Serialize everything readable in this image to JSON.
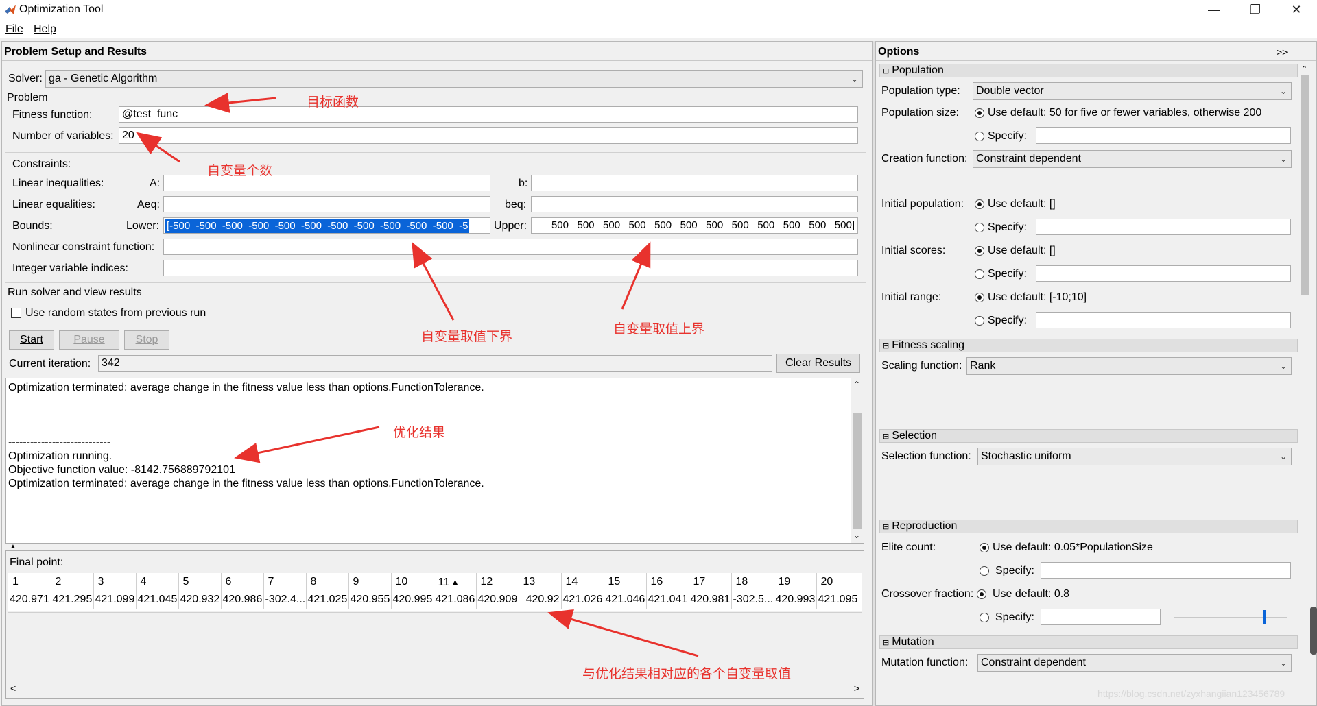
{
  "window": {
    "title": "Optimization Tool",
    "minimize": "—",
    "maximize": "❐",
    "close": "✕"
  },
  "menu": {
    "file": "File",
    "help": "Help"
  },
  "left": {
    "header": "Problem Setup and Results",
    "solver_label": "Solver:",
    "solver_value": "ga - Genetic Algorithm",
    "problem_label": "Problem",
    "fitness_label": "Fitness function:",
    "fitness_value": "@test_func",
    "nvars_label": "Number of variables:",
    "nvars_value": "20",
    "constraints_label": "Constraints:",
    "lin_ineq_label": "Linear inequalities:",
    "a_label": "A:",
    "b_label": "b:",
    "lin_eq_label": "Linear equalities:",
    "aeq_label": "Aeq:",
    "beq_label": "beq:",
    "bounds_label": "Bounds:",
    "lower_label": "Lower:",
    "lower_value": "[-500  -500  -500  -500  -500  -500  -500  -500  -500  -500  -500  -5",
    "upper_label": "Upper:",
    "upper_value": "500   500   500   500   500   500   500   500   500   500   500   500]",
    "nonlin_label": "Nonlinear constraint function:",
    "intvar_label": "Integer variable indices:",
    "run_label": "Run solver and view results",
    "random_states_label": "Use random states from previous run",
    "start_btn": "Start",
    "pause_btn": "Pause",
    "stop_btn": "Stop",
    "iter_label": "Current iteration:",
    "iter_value": "342",
    "clear_btn": "Clear Results",
    "output_lines": [
      "Optimization terminated: average change in the fitness value less than options.FunctionTolerance.",
      "",
      "",
      "",
      "----------------------------",
      "Optimization running.",
      "Objective function value: -8142.756889792101",
      "Optimization terminated: average change in the fitness value less than options.FunctionTolerance."
    ],
    "final_point_label": "Final point:",
    "final_headers": [
      "1",
      "2",
      "3",
      "4",
      "5",
      "6",
      "7",
      "8",
      "9",
      "10",
      "11 ▴",
      "12",
      "13",
      "14",
      "15",
      "16",
      "17",
      "18",
      "19",
      "20"
    ],
    "final_values": [
      "420.971",
      "421.295",
      "421.099",
      "421.045",
      "420.932",
      "420.986",
      "-302.4...",
      "421.025",
      "420.955",
      "420.995",
      "421.086",
      "420.909",
      "420.92",
      "421.026",
      "421.046",
      "421.041",
      "420.981",
      "-302.5...",
      "420.993",
      "421.095"
    ]
  },
  "options": {
    "header": "Options",
    "expand": ">>",
    "population": {
      "title": "Population",
      "type_label": "Population type:",
      "type_value": "Double vector",
      "size_label": "Population size:",
      "size_default": "Use default: 50 for five or fewer variables, otherwise 200",
      "specify": "Specify:",
      "creation_label": "Creation function:",
      "creation_value": "Constraint dependent",
      "init_pop_label": "Initial population:",
      "init_pop_default": "Use default: []",
      "init_scores_label": "Initial scores:",
      "init_scores_default": "Use default: []",
      "init_range_label": "Initial range:",
      "init_range_default": "Use default: [-10;10]"
    },
    "fitness_scaling": {
      "title": "Fitness scaling",
      "label": "Scaling function:",
      "value": "Rank"
    },
    "selection": {
      "title": "Selection",
      "label": "Selection function:",
      "value": "Stochastic uniform"
    },
    "reproduction": {
      "title": "Reproduction",
      "elite_label": "Elite count:",
      "elite_default": "Use default: 0.05*PopulationSize",
      "crossover_label": "Crossover fraction:",
      "crossover_default": "Use default: 0.8",
      "crossover_fraction": 0.8
    },
    "mutation": {
      "title": "Mutation",
      "label": "Mutation function:",
      "value": "Constraint dependent"
    }
  },
  "annotations": {
    "objective": "目标函数",
    "num_vars": "自变量个数",
    "lower_bound": "自变量取值下界",
    "upper_bound": "自变量取值上界",
    "result": "优化结果",
    "var_values": "与优化结果相对应的各个自变量取值",
    "color": "#e8322d"
  },
  "watermark": "https://blog.csdn.net/zyxhangiian123456789"
}
